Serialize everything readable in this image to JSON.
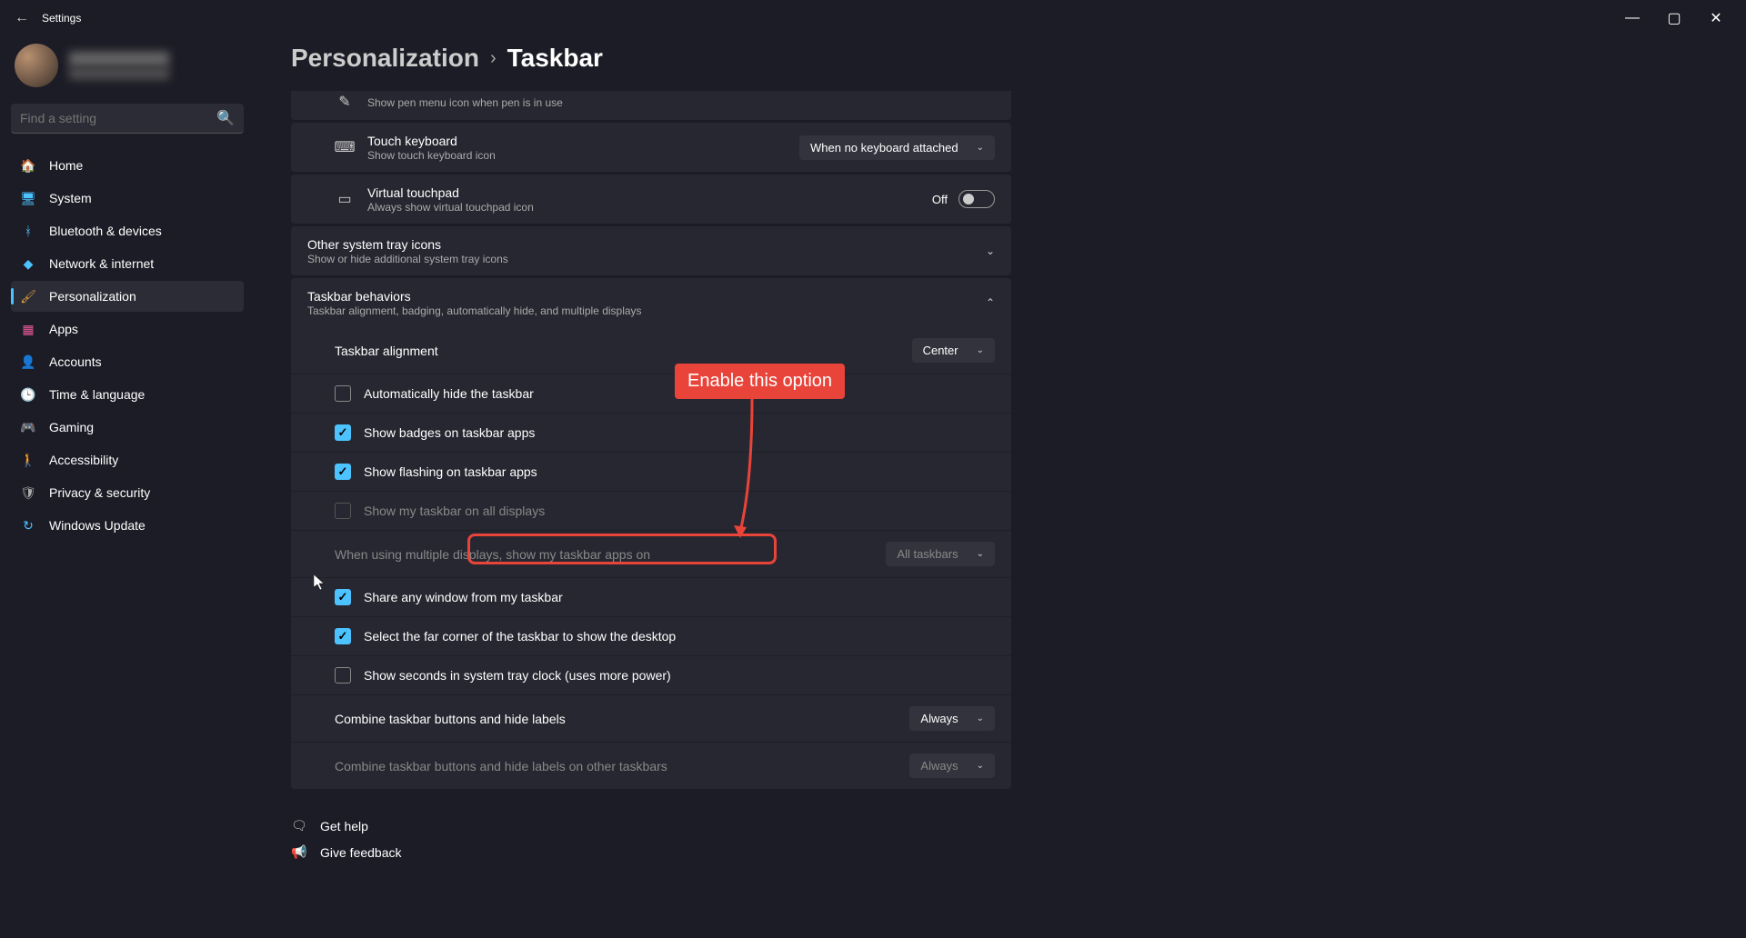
{
  "titlebar": {
    "back": "←",
    "title": "Settings",
    "min": "—",
    "restore": "▢",
    "close": "✕"
  },
  "profile": {
    "name": "████████",
    "email": "████████"
  },
  "search": {
    "placeholder": "Find a setting"
  },
  "nav": [
    {
      "icon": "🏠",
      "label": "Home",
      "color": "#e8a33d"
    },
    {
      "icon": "🖥",
      "label": "System",
      "color": "#4cc2ff"
    },
    {
      "icon": "ᚼ",
      "label": "Bluetooth & devices",
      "color": "#4cc2ff"
    },
    {
      "icon": "◆",
      "label": "Network & internet",
      "color": "#4cc2ff"
    },
    {
      "icon": "🖌",
      "label": "Personalization",
      "color": "#e8a33d",
      "active": true
    },
    {
      "icon": "▦",
      "label": "Apps",
      "color": "#e85a9a"
    },
    {
      "icon": "👤",
      "label": "Accounts",
      "color": "#4cc28f"
    },
    {
      "icon": "🕒",
      "label": "Time & language",
      "color": "#b8a890"
    },
    {
      "icon": "🎮",
      "label": "Gaming",
      "color": "#aaa"
    },
    {
      "icon": "🚶",
      "label": "Accessibility",
      "color": "#4cc2ff"
    },
    {
      "icon": "🛡",
      "label": "Privacy & security",
      "color": "#aaa"
    },
    {
      "icon": "↻",
      "label": "Windows Update",
      "color": "#4cc2ff"
    }
  ],
  "breadcrumb": {
    "parent": "Personalization",
    "sep": "›",
    "current": "Taskbar"
  },
  "rows": {
    "pen": {
      "desc": "Show pen menu icon when pen is in use"
    },
    "touch": {
      "title": "Touch keyboard",
      "desc": "Show touch keyboard icon",
      "dropdown": "When no keyboard attached"
    },
    "vtouch": {
      "title": "Virtual touchpad",
      "desc": "Always show virtual touchpad icon",
      "toggle": "Off"
    },
    "tray": {
      "title": "Other system tray icons",
      "desc": "Show or hide additional system tray icons"
    },
    "behaviors": {
      "title": "Taskbar behaviors",
      "desc": "Taskbar alignment, badging, automatically hide, and multiple displays"
    }
  },
  "behaviors": {
    "alignment": {
      "label": "Taskbar alignment",
      "value": "Center"
    },
    "autohide": "Automatically hide the taskbar",
    "badges": "Show badges on taskbar apps",
    "flashing": "Show flashing on taskbar apps",
    "alldisplays": "Show my taskbar on all displays",
    "multi": {
      "label": "When using multiple displays, show my taskbar apps on",
      "value": "All taskbars"
    },
    "share": "Share any window from my taskbar",
    "corner": "Select the far corner of the taskbar to show the desktop",
    "seconds": "Show seconds in system tray clock (uses more power)",
    "combine": {
      "label": "Combine taskbar buttons and hide labels",
      "value": "Always"
    },
    "combine_other": {
      "label": "Combine taskbar buttons and hide labels on other taskbars",
      "value": "Always"
    }
  },
  "footer": {
    "help": "Get help",
    "feedback": "Give feedback"
  },
  "annotation": {
    "text": "Enable this option"
  }
}
